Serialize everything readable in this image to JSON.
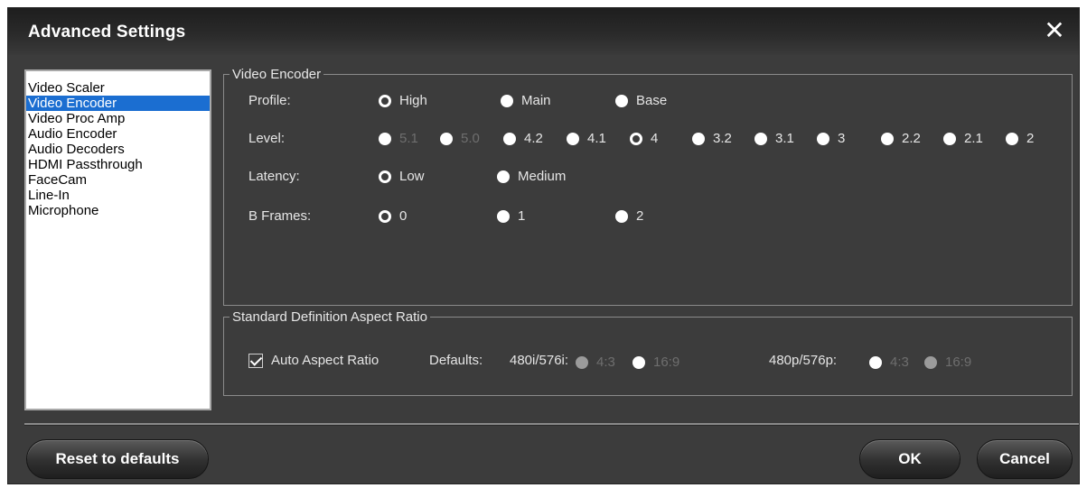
{
  "window": {
    "title": "Advanced Settings",
    "close_glyph": "✕"
  },
  "sidebar": {
    "items": [
      {
        "label": "Video Scaler",
        "selected": false
      },
      {
        "label": "Video Encoder",
        "selected": true
      },
      {
        "label": "Video Proc Amp",
        "selected": false
      },
      {
        "label": "Audio Encoder",
        "selected": false
      },
      {
        "label": "Audio Decoders",
        "selected": false
      },
      {
        "label": "HDMI Passthrough",
        "selected": false
      },
      {
        "label": "FaceCam",
        "selected": false
      },
      {
        "label": "Line-In",
        "selected": false
      },
      {
        "label": "Microphone",
        "selected": false
      }
    ]
  },
  "encoder": {
    "legend": "Video Encoder",
    "profile": {
      "label": "Profile:",
      "options": [
        {
          "label": "High",
          "checked": true,
          "disabled": false
        },
        {
          "label": "Main",
          "checked": false,
          "disabled": false
        },
        {
          "label": "Base",
          "checked": false,
          "disabled": false
        }
      ]
    },
    "level": {
      "label": "Level:",
      "options": [
        {
          "label": "5.1",
          "checked": false,
          "disabled": true
        },
        {
          "label": "5.0",
          "checked": false,
          "disabled": true
        },
        {
          "label": "4.2",
          "checked": false,
          "disabled": false
        },
        {
          "label": "4.1",
          "checked": false,
          "disabled": false
        },
        {
          "label": "4",
          "checked": true,
          "disabled": false
        },
        {
          "label": "3.2",
          "checked": false,
          "disabled": false
        },
        {
          "label": "3.1",
          "checked": false,
          "disabled": false
        },
        {
          "label": "3",
          "checked": false,
          "disabled": false
        },
        {
          "label": "2.2",
          "checked": false,
          "disabled": false
        },
        {
          "label": "2.1",
          "checked": false,
          "disabled": false
        },
        {
          "label": "2",
          "checked": false,
          "disabled": false
        }
      ]
    },
    "latency": {
      "label": "Latency:",
      "options": [
        {
          "label": "Low",
          "checked": true,
          "disabled": false
        },
        {
          "label": "Medium",
          "checked": false,
          "disabled": false
        }
      ]
    },
    "bframes": {
      "label": "B Frames:",
      "options": [
        {
          "label": "0",
          "checked": true,
          "disabled": false
        },
        {
          "label": "1",
          "checked": false,
          "disabled": false
        },
        {
          "label": "2",
          "checked": false,
          "disabled": false
        }
      ]
    }
  },
  "aspect": {
    "legend": "Standard Definition Aspect Ratio",
    "auto_label": "Auto Aspect Ratio",
    "auto_checked": true,
    "defaults_label": "Defaults:",
    "group1": {
      "label": "480i/576i:",
      "options": [
        {
          "label": "4:3",
          "checked": false,
          "disabled": true
        },
        {
          "label": "16:9",
          "checked": false,
          "disabled": true
        }
      ]
    },
    "group2": {
      "label": "480p/576p:",
      "options": [
        {
          "label": "4:3",
          "checked": false,
          "disabled": true
        },
        {
          "label": "16:9",
          "checked": false,
          "disabled": true
        }
      ]
    }
  },
  "buttons": {
    "reset": "Reset to defaults",
    "ok": "OK",
    "cancel": "Cancel"
  }
}
